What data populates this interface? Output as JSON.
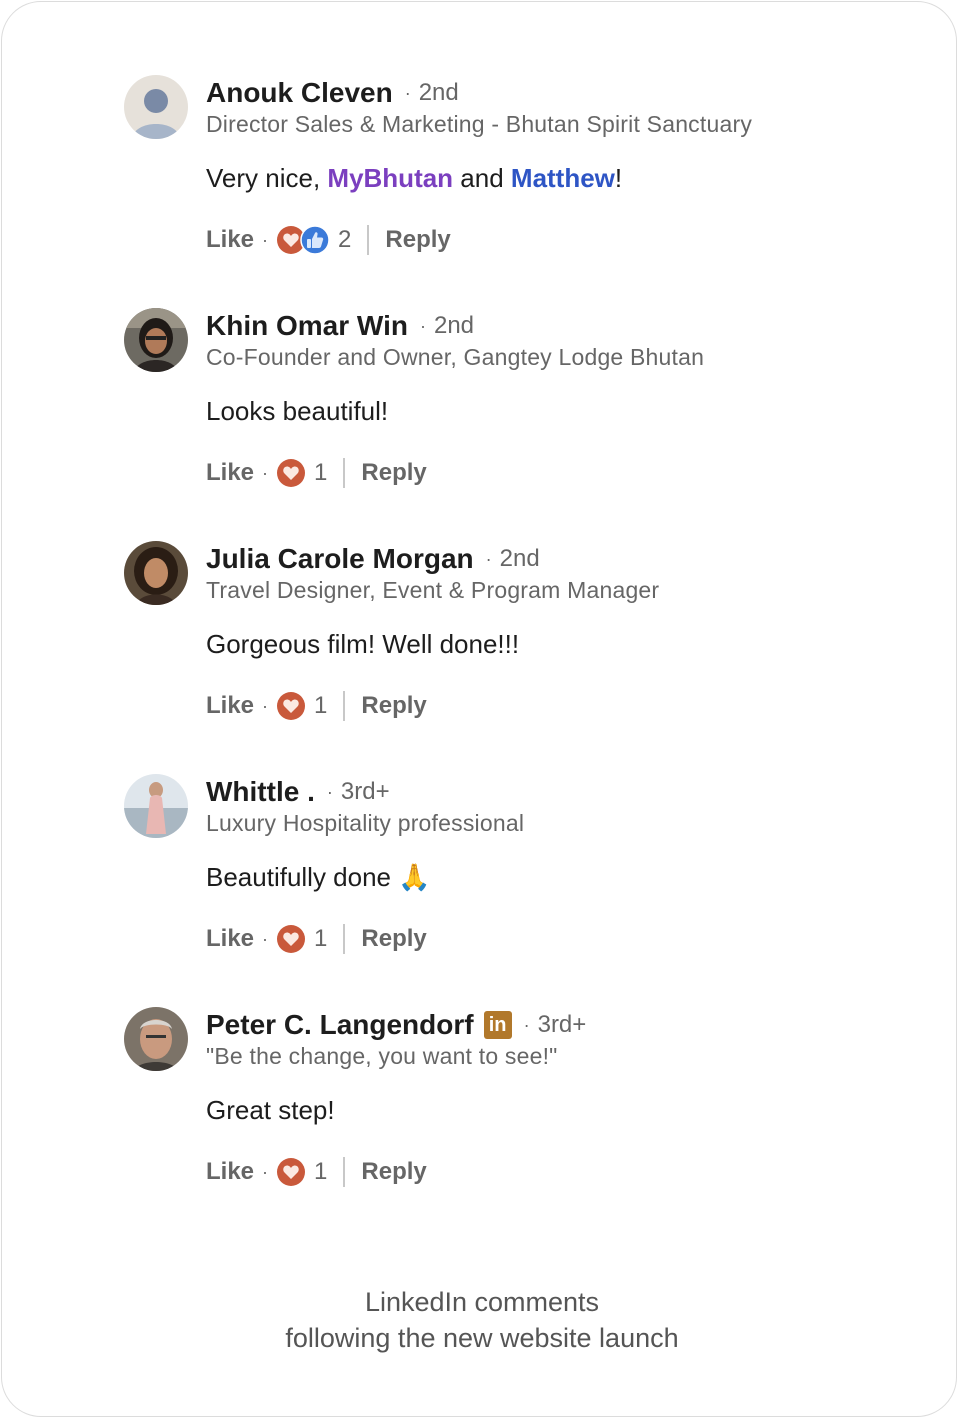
{
  "comments": [
    {
      "name": "Anouk Cleven",
      "degree": "2nd",
      "headline": "Director Sales & Marketing - Bhutan Spirit Sanctuary",
      "body_prefix": "Very nice, ",
      "mention_1": "MyBhutan",
      "body_middle": " and ",
      "mention_2": "Matthew",
      "body_suffix": "!",
      "like_label": "Like",
      "reaction_icons": [
        "heart-icon",
        "thumbs-up-icon"
      ],
      "reaction_count": "2",
      "reply_label": "Reply"
    },
    {
      "name": "Khin Omar Win",
      "degree": "2nd",
      "headline": "Co-Founder and Owner, Gangtey Lodge Bhutan",
      "body": "Looks beautiful!",
      "like_label": "Like",
      "reaction_icons": [
        "heart-icon"
      ],
      "reaction_count": "1",
      "reply_label": "Reply"
    },
    {
      "name": "Julia Carole Morgan",
      "degree": "2nd",
      "headline": "Travel Designer, Event & Program Manager",
      "body": "Gorgeous film! Well done!!!",
      "like_label": "Like",
      "reaction_icons": [
        "heart-icon"
      ],
      "reaction_count": "1",
      "reply_label": "Reply"
    },
    {
      "name": "Whittle .",
      "degree": "3rd+",
      "headline": "Luxury Hospitality professional",
      "body": "Beautifully done 🙏",
      "like_label": "Like",
      "reaction_icons": [
        "heart-icon"
      ],
      "reaction_count": "1",
      "reply_label": "Reply"
    },
    {
      "name": "Peter C. Langendorf",
      "badge": "in",
      "degree": "3rd+",
      "headline": "\"Be the change, you want to see!\"",
      "body": "Great step!",
      "like_label": "Like",
      "reaction_icons": [
        "heart-icon"
      ],
      "reaction_count": "1",
      "reply_label": "Reply"
    }
  ],
  "separator": "·",
  "caption": {
    "line1": "LinkedIn comments",
    "line2": "following the new website launch"
  },
  "colors": {
    "mention_purple": "#7b3fbf",
    "mention_blue": "#2e55c5",
    "heart_reaction": "#c9593b",
    "like_reaction": "#3b7ad9",
    "premium_badge": "#b1782b"
  }
}
